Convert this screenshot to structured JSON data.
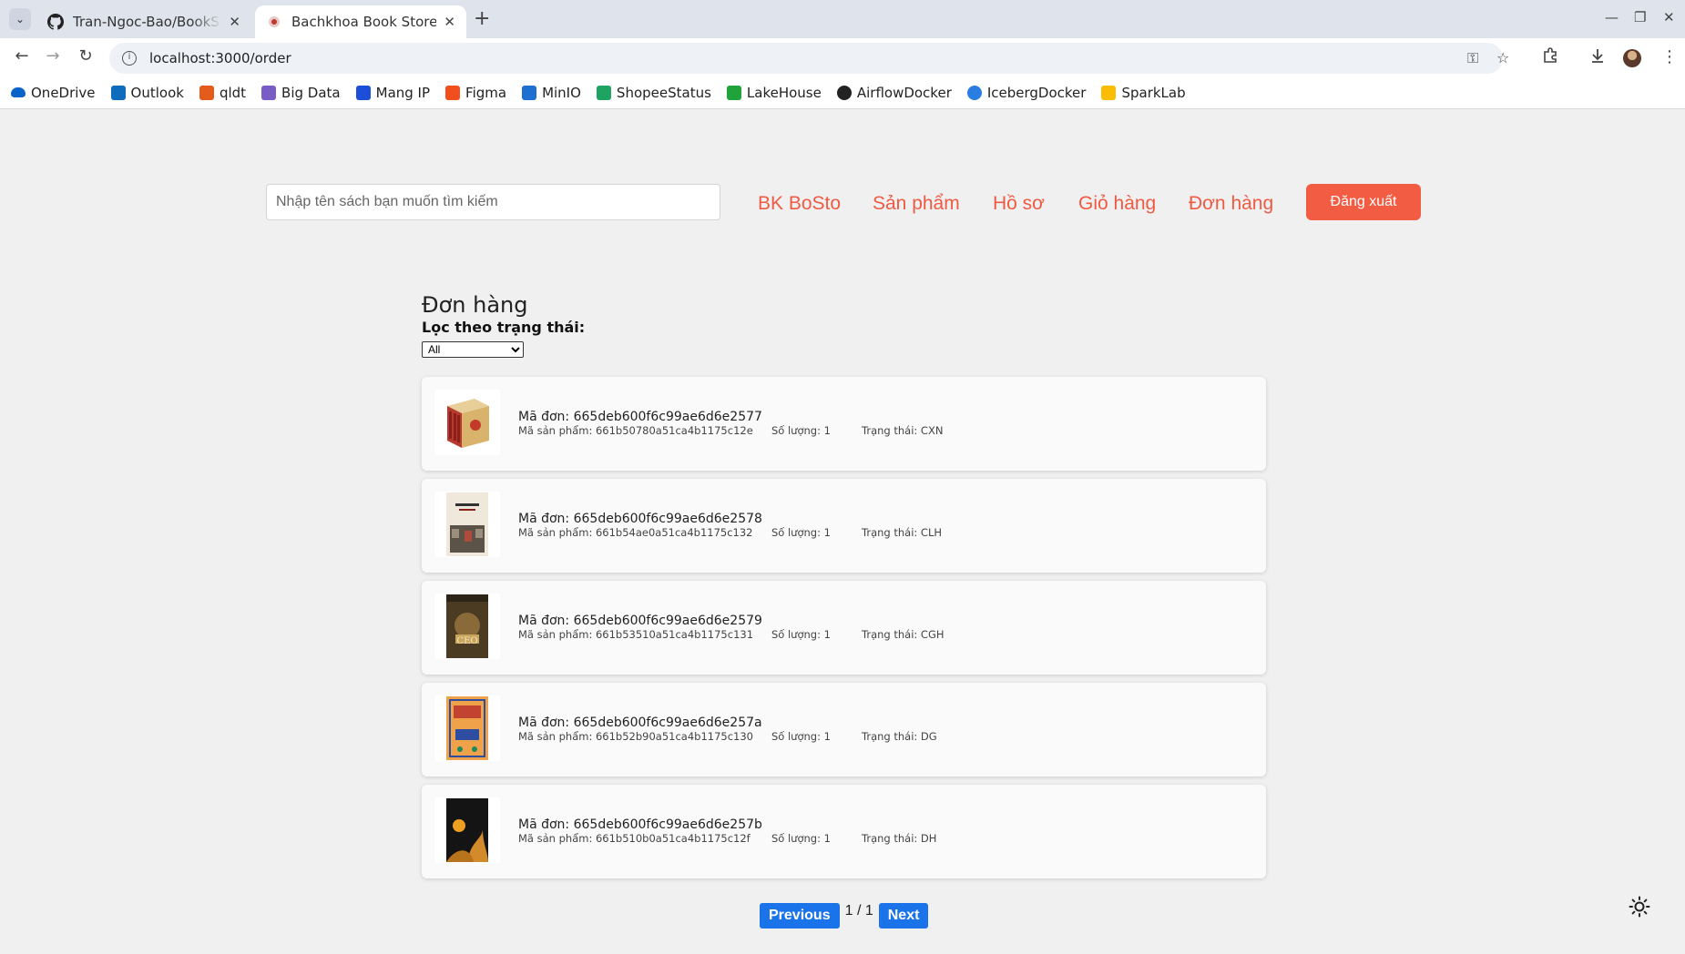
{
  "browser": {
    "tabs": [
      {
        "title": "Tran-Ngoc-Bao/BookSell"
      },
      {
        "title": "Bachkhoa Book Store"
      }
    ],
    "url": "localhost:3000/order",
    "bookmarks": [
      {
        "label": "OneDrive",
        "icon": "cloud-icon",
        "color": "#0a63c9"
      },
      {
        "label": "Outlook",
        "icon": "outlook-icon",
        "color": "#0f6cbd"
      },
      {
        "label": "qldt",
        "icon": "qldt-icon",
        "color": "#e45b1c"
      },
      {
        "label": "Big Data",
        "icon": "sparkle-icon",
        "color": "#7a5cc7"
      },
      {
        "label": "Mang IP",
        "icon": "d-icon",
        "color": "#1d4ed8"
      },
      {
        "label": "Figma",
        "icon": "figma-icon",
        "color": "#f24e1e"
      },
      {
        "label": "MinIO",
        "icon": "tb-icon",
        "color": "#1f6fd1"
      },
      {
        "label": "ShopeeStatus",
        "icon": "sheet-icon",
        "color": "#1ea362"
      },
      {
        "label": "LakeHouse",
        "icon": "lakehouse-icon",
        "color": "#1fa33a"
      },
      {
        "label": "AirflowDocker",
        "icon": "github-icon",
        "color": "#222222"
      },
      {
        "label": "IcebergDocker",
        "icon": "globe-icon",
        "color": "#2a7de1"
      },
      {
        "label": "SparkLab",
        "icon": "drive-icon",
        "color": "#fbbc04"
      }
    ]
  },
  "header": {
    "search_placeholder": "Nhập tên sách bạn muốn tìm kiếm",
    "nav": [
      "BK BoSto",
      "Sản phẩm",
      "Hồ sơ",
      "Giỏ hàng",
      "Đơn hàng"
    ],
    "logout_label": "Đăng xuất"
  },
  "main": {
    "title": "Đơn hàng",
    "filter_label": "Lọc theo trạng thái:",
    "filter_value": "All",
    "orders": [
      {
        "order_id": "Mã đơn: 665deb600f6c99ae6d6e2577",
        "product_id": "Mã sản phẩm: 661b50780a51ca4b1175c12e",
        "quantity": "Số lượng: 1",
        "status": "Trạng thái: CXN",
        "cover": "box-set-cover"
      },
      {
        "order_id": "Mã đơn: 665deb600f6c99ae6d6e2578",
        "product_id": "Mã sản phẩm: 661b54ae0a51ca4b1175c132",
        "quantity": "Số lượng: 1",
        "status": "Trạng thái: CLH",
        "cover": "street-cover"
      },
      {
        "order_id": "Mã đơn: 665deb600f6c99ae6d6e2579",
        "product_id": "Mã sản phẩm: 661b53510a51ca4b1175c131",
        "quantity": "Số lượng: 1",
        "status": "Trạng thái: CGH",
        "cover": "ceo-cover"
      },
      {
        "order_id": "Mã đơn: 665deb600f6c99ae6d6e257a",
        "product_id": "Mã sản phẩm: 661b52b90a51ca4b1175c130",
        "quantity": "Số lượng: 1",
        "status": "Trạng thái: DG",
        "cover": "ai-cap-cover"
      },
      {
        "order_id": "Mã đơn: 665deb600f6c99ae6d6e257b",
        "product_id": "Mã sản phẩm: 661b510b0a51ca4b1175c12f",
        "quantity": "Số lượng: 1",
        "status": "Trạng thái: DH",
        "cover": "dark-cover"
      }
    ]
  },
  "pagination": {
    "previous_label": "Previous",
    "page_text": "1 / 1",
    "next_label": "Next"
  },
  "colors": {
    "accent": "#ef5a43",
    "logout": "#f25c43",
    "pagination": "#1a73e8"
  }
}
